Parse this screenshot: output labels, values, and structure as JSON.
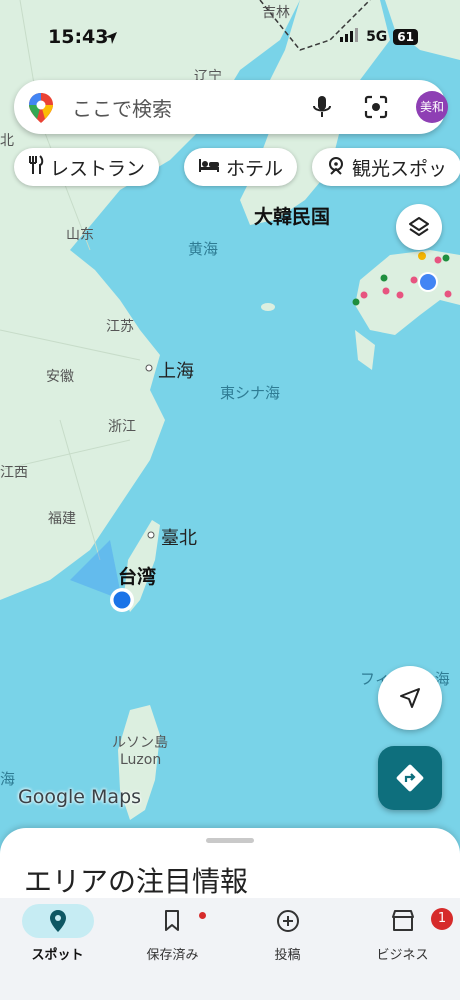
{
  "status": {
    "time": "15:43",
    "network": "5G",
    "battery": "61"
  },
  "search": {
    "placeholder": "ここで検索",
    "avatar": "美和"
  },
  "chips": [
    {
      "label": "レストラン",
      "icon": "restaurant-icon"
    },
    {
      "label": "ホテル",
      "icon": "hotel-icon"
    },
    {
      "label": "観光スポッ",
      "icon": "attraction-icon"
    }
  ],
  "map_labels": {
    "jilin": "吉林",
    "liaoning": "辽宁",
    "korea": "大韓民国",
    "shandong": "山东",
    "yellow_sea": "黄海",
    "jiangsu": "江苏",
    "anhui": "安徽",
    "shanghai": "上海",
    "east_china_sea": "東シナ海",
    "zhejiang": "浙江",
    "jiangxi": "江西",
    "fujian": "福建",
    "taipei": "臺北",
    "taiwan": "台湾",
    "philippine_sea": "フィリピン海",
    "luzon_jp": "ルソン島",
    "luzon": "Luzon",
    "south_sea": "海",
    "edge_left": "北"
  },
  "logo": "Google Maps",
  "sheet": {
    "title": "エリアの注目情報"
  },
  "tabs": [
    {
      "label": "スポット",
      "active": true
    },
    {
      "label": "保存済み"
    },
    {
      "label": "投稿"
    },
    {
      "label": "ビジネス",
      "badge": "1"
    }
  ],
  "colors": {
    "water": "#79d3e8",
    "land": "#dcefe0",
    "accent": "#0e6f7d",
    "avatar": "#8e3fb4"
  }
}
